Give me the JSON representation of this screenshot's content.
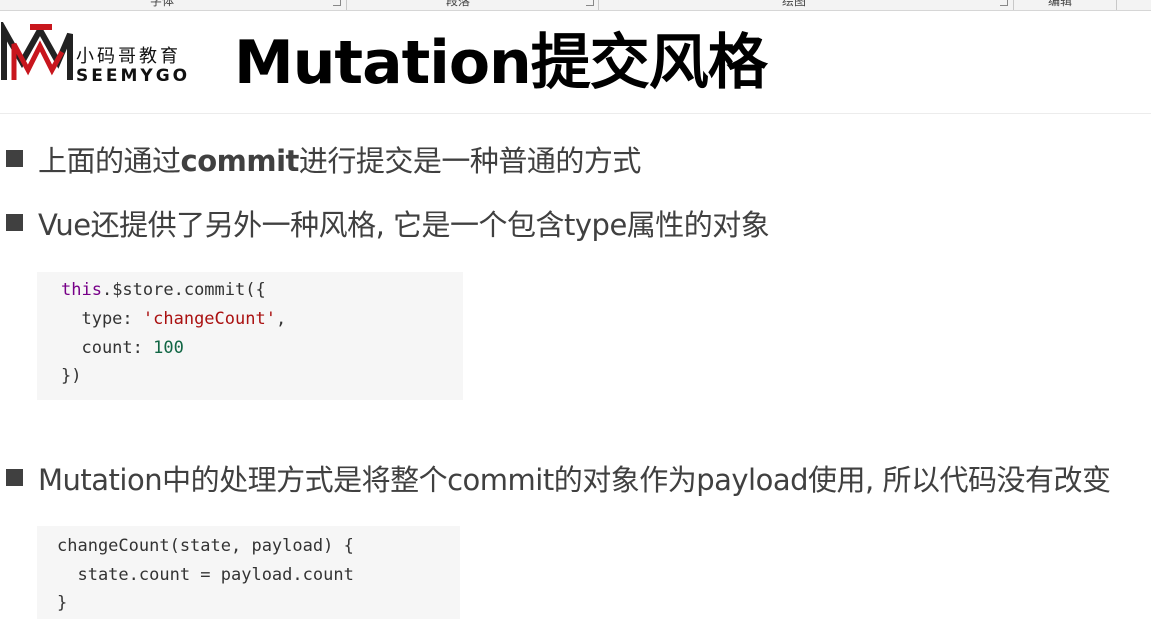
{
  "ribbon": {
    "labels": [
      "字体",
      "段落",
      "绘图",
      "编辑"
    ]
  },
  "logo": {
    "cn_text": "小码哥教育",
    "en_text": "SEEMYGO"
  },
  "title": "Mutation提交风格",
  "bullets": [
    {
      "pre": "上面的通过",
      "bold": "commit",
      "post": "进行提交是一种普通的方式"
    },
    {
      "pre": "Vue还提供了另外一种风格, 它是一个包含type属性的对象",
      "bold": "",
      "post": ""
    },
    {
      "pre": "Mutation中的处理方式是将整个commit的对象作为payload使用, 所以代码没有改变",
      "bold": "",
      "post": ""
    }
  ],
  "code1": {
    "line1_kw": "this",
    "line1_rest": ".$store.commit({",
    "line2_key": "  type: ",
    "line2_str": "'changeCount'",
    "line2_end": ",",
    "line3_key": "  count: ",
    "line3_num": "100",
    "line4": "})"
  },
  "code2": {
    "line1": "changeCount(state, payload) {",
    "line2": "  state.count = payload.count",
    "line3": "}"
  },
  "colors": {
    "logo_red": "#c8161d",
    "logo_dark": "#222222",
    "keyword": "#770088",
    "string": "#aa1111",
    "number": "#116644",
    "code_bg": "#f6f6f6"
  }
}
